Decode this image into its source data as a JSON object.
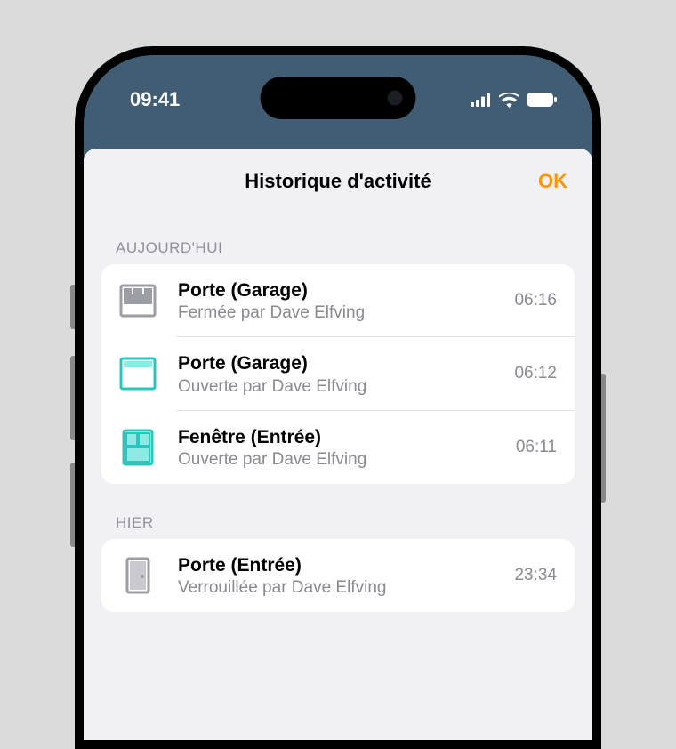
{
  "status_bar": {
    "time": "09:41"
  },
  "header": {
    "title": "Historique d'activité",
    "done": "OK"
  },
  "sections": [
    {
      "label": "AUJOURD'HUI",
      "rows": [
        {
          "icon": "garage-closed",
          "title": "Porte (Garage)",
          "subtitle": "Fermée par Dave Elfving",
          "time": "06:16"
        },
        {
          "icon": "garage-open",
          "title": "Porte (Garage)",
          "subtitle": "Ouverte par Dave Elfving",
          "time": "06:12"
        },
        {
          "icon": "window-open",
          "title": "Fenêtre (Entrée)",
          "subtitle": "Ouverte par Dave Elfving",
          "time": "06:11"
        }
      ]
    },
    {
      "label": "HIER",
      "rows": [
        {
          "icon": "door-closed",
          "title": "Porte (Entrée)",
          "subtitle": "Verrouillée par Dave Elfving",
          "time": "23:34"
        }
      ]
    }
  ],
  "icon_colors": {
    "inactive": "#9d9da4",
    "active": "#28c7bd"
  }
}
